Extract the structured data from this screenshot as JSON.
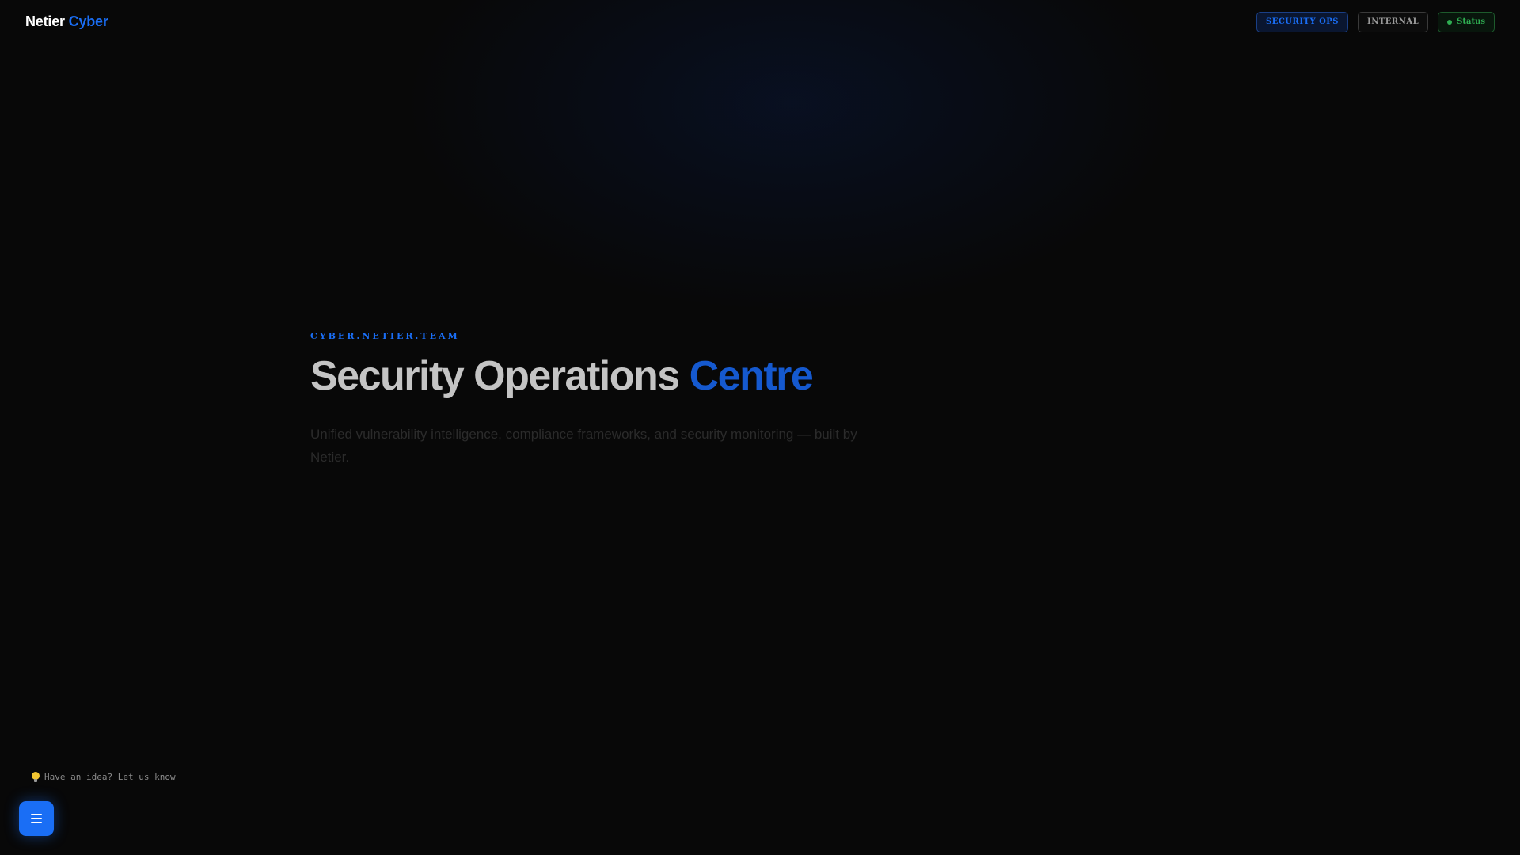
{
  "header": {
    "brand_main": "Netier",
    "brand_accent": "Cyber",
    "pills": {
      "security_ops": "SECURITY OPS",
      "internal": "INTERNAL",
      "status": "Status"
    }
  },
  "hero": {
    "eyebrow": "CYBER.NETIER.TEAM",
    "title_main": "Security Operations",
    "title_accent": "Centre",
    "subtitle": "Unified vulnerability intelligence, compliance frameworks, and security monitoring — built by Netier."
  },
  "feedback": {
    "icon": "lightbulb-icon",
    "text": "Have an idea? Let us know"
  },
  "menu_button": {
    "icon": "menu-icon"
  },
  "colors": {
    "accent": "#1a6ef5",
    "status_green": "#2fae52",
    "background": "#080808"
  }
}
